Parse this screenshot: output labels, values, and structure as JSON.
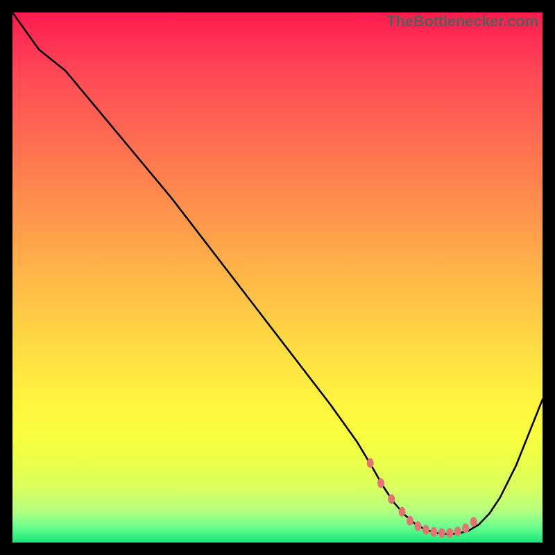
{
  "attribution": "TheBottlenecker.com",
  "chart_data": {
    "type": "line",
    "title": "",
    "xlabel": "",
    "ylabel": "",
    "xlim": [
      0,
      100
    ],
    "ylim": [
      0,
      100
    ],
    "curve": {
      "x": [
        0,
        5,
        10,
        15,
        20,
        25,
        30,
        35,
        40,
        45,
        50,
        55,
        60,
        65,
        68,
        70,
        72,
        74,
        76,
        78,
        80,
        82,
        84,
        86,
        88,
        90,
        92,
        95,
        100
      ],
      "y": [
        100,
        93,
        89,
        83,
        77,
        71,
        65,
        58.5,
        52,
        45.5,
        39,
        32.5,
        26,
        19,
        14,
        10.5,
        7.5,
        5.2,
        3.5,
        2.4,
        1.8,
        1.6,
        1.7,
        2.2,
        3.4,
        5.5,
        8.5,
        14.5,
        27
      ]
    },
    "markers": {
      "x": [
        67.5,
        69.5,
        71.5,
        73.5,
        75.0,
        76.5,
        78.0,
        79.5,
        81.0,
        82.5,
        84.0,
        85.5,
        87.0
      ],
      "y": [
        15.0,
        11.2,
        8.2,
        5.8,
        4.1,
        3.1,
        2.4,
        2.0,
        1.8,
        1.8,
        2.1,
        2.7,
        3.9
      ],
      "color": "#e57373",
      "rx": 5,
      "ry": 7
    },
    "colors": {
      "line": "#000000",
      "background_top": "#ff1a4d",
      "background_bottom": "#14e87a"
    }
  }
}
